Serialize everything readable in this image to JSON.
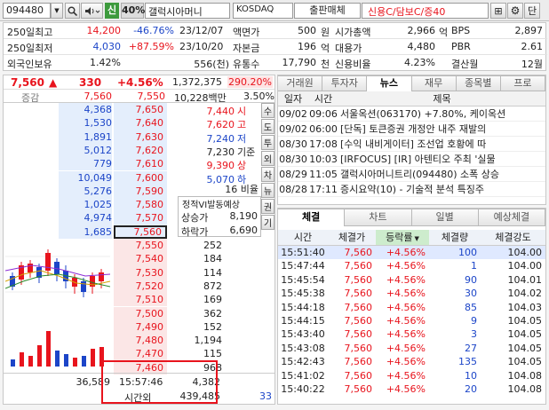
{
  "toolbar": {
    "code": "094480",
    "shin": "신",
    "pct": "40%",
    "stock_name": "갤럭시아머니",
    "market": "KOSDAQ",
    "sector": "출판매체",
    "credit": "신용C/담보C/증40",
    "right_btn": "단"
  },
  "info": {
    "row1": {
      "l1": "250일최고",
      "v1": "14,200",
      "v2": "-46.76%",
      "d": "23/12/07",
      "l2": "액면가",
      "v3": "500",
      "u3": "원",
      "l3": "시가총액",
      "v4": "2,966",
      "u4": "억",
      "l4": "BPS",
      "v5": "2,897"
    },
    "row2": {
      "l1": "250일최저",
      "v1": "4,030",
      "v2": "+87.59%",
      "d": "23/10/20",
      "l2": "자본금",
      "v3": "196",
      "u3": "억",
      "l3": "대용가",
      "v4": "4,480",
      "l4": "PBR",
      "v5": "2.61"
    },
    "row3": {
      "l1": "외국인보유",
      "v1": "1.42%",
      "v2": "556(천)",
      "l2": "유통수",
      "v3": "17,790",
      "u3": "천",
      "l3": "신용비율",
      "v4": "4.23%",
      "l4": "결산월",
      "v5": "12월"
    }
  },
  "price": {
    "current": "7,560",
    "arrow": "▲",
    "change": "330",
    "rate": "+4.56%",
    "volume": "1,372,375",
    "vol_rate": "290.20%",
    "amount": "10,228백만",
    "amt_rate": "3.50%",
    "label_diff": "증감",
    "left_price": "7,560",
    "right_price": "7,550"
  },
  "asks": [
    {
      "qty": "4,368",
      "price": "7,650"
    },
    {
      "qty": "1,530",
      "price": "7,640"
    },
    {
      "qty": "1,891",
      "price": "7,630"
    },
    {
      "qty": "5,012",
      "price": "7,620"
    },
    {
      "qty": "779",
      "price": "7,610"
    },
    {
      "qty": "10,049",
      "price": "7,600"
    },
    {
      "qty": "5,276",
      "price": "7,590"
    },
    {
      "qty": "1,025",
      "price": "7,580"
    },
    {
      "qty": "4,974",
      "price": "7,570"
    },
    {
      "qty": "1,685",
      "price": "7,560"
    }
  ],
  "bids": [
    {
      "price": "7,550",
      "qty": "252"
    },
    {
      "price": "7,540",
      "qty": "184"
    },
    {
      "price": "7,530",
      "qty": "114"
    },
    {
      "price": "7,520",
      "qty": "872"
    },
    {
      "price": "7,510",
      "qty": "169"
    },
    {
      "price": "7,500",
      "qty": "362"
    },
    {
      "price": "7,490",
      "qty": "152"
    },
    {
      "price": "7,480",
      "qty": "1,194"
    },
    {
      "price": "7,470",
      "qty": "115"
    },
    {
      "price": "7,460",
      "qty": "968"
    }
  ],
  "summary": [
    {
      "label": "시",
      "price": "7,440"
    },
    {
      "label": "고",
      "price": "7,620"
    },
    {
      "label": "저",
      "price": "7,240"
    },
    {
      "label": "기준",
      "price": "7,230"
    },
    {
      "label": "상",
      "price": "9,390"
    },
    {
      "label": "하",
      "price": "5,070"
    }
  ],
  "vi_label": "16 비율",
  "exp": {
    "title": "정적VI발동예상",
    "up_label": "상승가",
    "up": "8,190",
    "down_label": "하락가",
    "down": "6,690"
  },
  "side_tabs": [
    "수",
    "도",
    "투",
    "외",
    "차",
    "뉴",
    "권",
    "기"
  ],
  "bottom": {
    "left_total": "36,589",
    "time": "15:57:46",
    "time_qty": "4,382",
    "after_label": "시간외",
    "after_qty": "439,485",
    "right_total": "33"
  },
  "news_tabs": [
    "거래원",
    "투자자",
    "뉴스",
    "재무",
    "종목별",
    "프로"
  ],
  "news_headers": [
    "일자",
    "시간",
    "제목"
  ],
  "news": [
    {
      "date": "09/02",
      "time": "09:06",
      "title": "서울옥션(063170) +7.80%, 케이옥션"
    },
    {
      "date": "09/02",
      "time": "06:00",
      "title": "[단독] 토큰증권 개정안 내주 재발의"
    },
    {
      "date": "08/30",
      "time": "17:08",
      "title": "[수익 내비게이터] 조선업 호황에 따"
    },
    {
      "date": "08/30",
      "time": "10:03",
      "title": "[IRFOCUS] [IR] 아텐티오 주최 '실물"
    },
    {
      "date": "08/29",
      "time": "11:05",
      "title": "갤럭시아머니트리(094480) 소폭 상승"
    },
    {
      "date": "08/28",
      "time": "17:11",
      "title": "증시요약(10) - 기술적 분석 특징주"
    }
  ],
  "trade_tabs": [
    "체결",
    "차트",
    "일별",
    "예상체결"
  ],
  "trade_headers": [
    "시간",
    "체결가",
    "등락률",
    "체결량",
    "체결강도"
  ],
  "trades": [
    {
      "time": "15:51:40",
      "price": "7,560",
      "rate": "+4.56%",
      "qty": "100",
      "str": "104.00"
    },
    {
      "time": "15:47:44",
      "price": "7,560",
      "rate": "+4.56%",
      "qty": "1",
      "str": "104.00"
    },
    {
      "time": "15:45:54",
      "price": "7,560",
      "rate": "+4.56%",
      "qty": "90",
      "str": "104.01"
    },
    {
      "time": "15:45:38",
      "price": "7,560",
      "rate": "+4.56%",
      "qty": "30",
      "str": "104.02"
    },
    {
      "time": "15:44:18",
      "price": "7,560",
      "rate": "+4.56%",
      "qty": "85",
      "str": "104.03"
    },
    {
      "time": "15:44:15",
      "price": "7,560",
      "rate": "+4.56%",
      "qty": "9",
      "str": "104.05"
    },
    {
      "time": "15:43:40",
      "price": "7,560",
      "rate": "+4.56%",
      "qty": "3",
      "str": "104.05"
    },
    {
      "time": "15:43:08",
      "price": "7,560",
      "rate": "+4.56%",
      "qty": "27",
      "str": "104.05"
    },
    {
      "time": "15:42:43",
      "price": "7,560",
      "rate": "+4.56%",
      "qty": "135",
      "str": "104.05"
    },
    {
      "time": "15:41:02",
      "price": "7,560",
      "rate": "+4.56%",
      "qty": "10",
      "str": "104.08"
    },
    {
      "time": "15:40:22",
      "price": "7,560",
      "rate": "+4.56%",
      "qty": "20",
      "str": "104.08"
    }
  ],
  "colors": {
    "up": "#e8141d",
    "down": "#1c45c8",
    "highlight": "#e8141d"
  }
}
